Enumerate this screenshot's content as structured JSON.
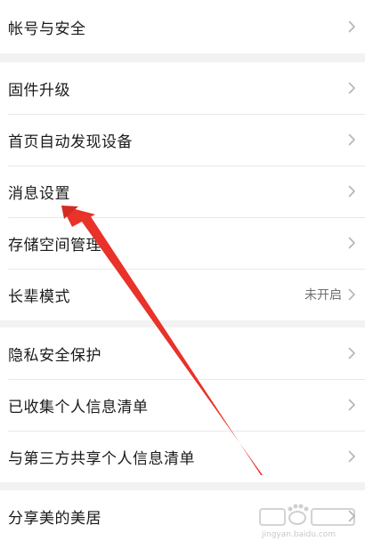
{
  "groups": [
    {
      "items": [
        {
          "label": "帐号与安全"
        }
      ]
    },
    {
      "items": [
        {
          "label": "固件升级"
        },
        {
          "label": "首页自动发现设备"
        },
        {
          "label": "消息设置"
        },
        {
          "label": "存储空间管理"
        },
        {
          "label": "长辈模式",
          "value": "未开启"
        }
      ]
    },
    {
      "items": [
        {
          "label": "隐私安全保护"
        },
        {
          "label": "已收集个人信息清单"
        },
        {
          "label": "与第三方共享个人信息清单"
        }
      ]
    },
    {
      "items": [
        {
          "label": "分享美的美居"
        }
      ]
    }
  ],
  "icons": {
    "row_arrow": "chevron-right-icon"
  },
  "annotation": {
    "arrow_color": "#e8322a"
  },
  "watermark": {
    "brand": "Baidu经验",
    "url": "jingyan.baidu.com"
  }
}
